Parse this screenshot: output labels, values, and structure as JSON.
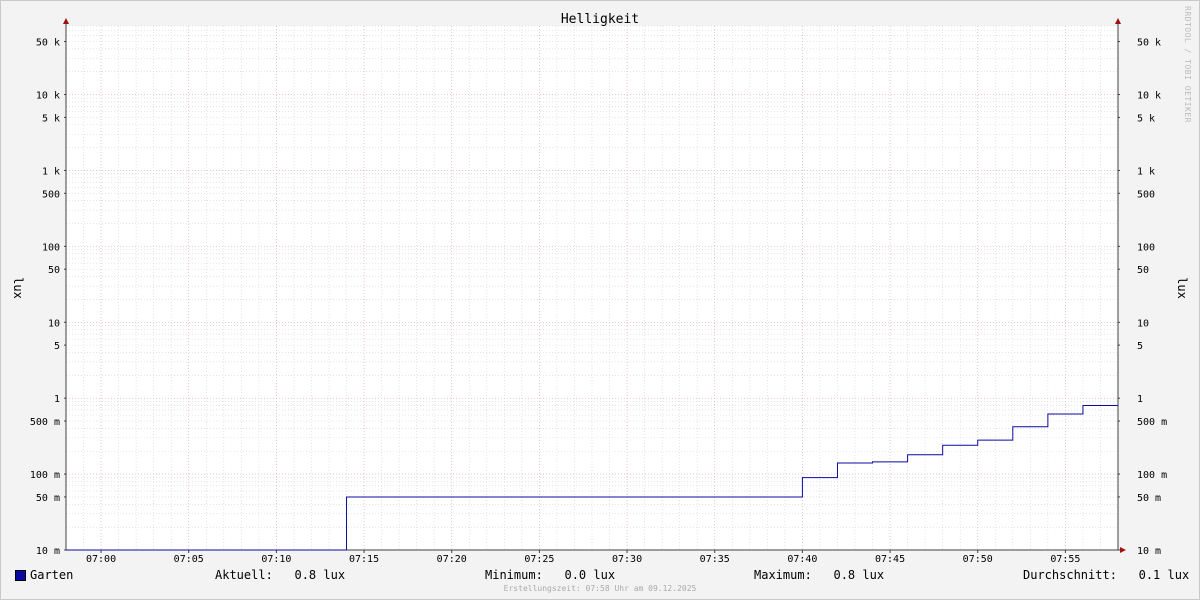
{
  "chart_data": {
    "type": "line",
    "title": "Helligkeit",
    "ylabel": "lux",
    "y_scale": "log",
    "ylim": [
      0.01,
      80000
    ],
    "y_ticks": [
      {
        "value": 0.01,
        "label": "10 m"
      },
      {
        "value": 0.05,
        "label": "50 m"
      },
      {
        "value": 0.1,
        "label": "100 m"
      },
      {
        "value": 0.5,
        "label": "500 m"
      },
      {
        "value": 1,
        "label": "1"
      },
      {
        "value": 5,
        "label": "5"
      },
      {
        "value": 10,
        "label": "10"
      },
      {
        "value": 50,
        "label": "50"
      },
      {
        "value": 100,
        "label": "100"
      },
      {
        "value": 500,
        "label": "500"
      },
      {
        "value": 1000,
        "label": "1 k"
      },
      {
        "value": 5000,
        "label": "5 k"
      },
      {
        "value": 10000,
        "label": "10 k"
      },
      {
        "value": 50000,
        "label": "50 k"
      }
    ],
    "x_ticks": [
      "07:00",
      "07:05",
      "07:10",
      "07:15",
      "07:20",
      "07:25",
      "07:30",
      "07:35",
      "07:40",
      "07:45",
      "07:50",
      "07:55"
    ],
    "xlim": [
      "06:58",
      "07:58"
    ],
    "series": [
      {
        "name": "Garten",
        "color": "#0a0aa0",
        "step": true,
        "points": [
          {
            "x": "06:58",
            "y": 0.01
          },
          {
            "x": "07:14",
            "y": 0.05
          },
          {
            "x": "07:40",
            "y": 0.09
          },
          {
            "x": "07:42",
            "y": 0.14
          },
          {
            "x": "07:44",
            "y": 0.145
          },
          {
            "x": "07:46",
            "y": 0.18
          },
          {
            "x": "07:48",
            "y": 0.24
          },
          {
            "x": "07:50",
            "y": 0.28
          },
          {
            "x": "07:52",
            "y": 0.42
          },
          {
            "x": "07:54",
            "y": 0.62
          },
          {
            "x": "07:56",
            "y": 0.8
          },
          {
            "x": "07:58",
            "y": 0.8
          }
        ]
      }
    ],
    "grid": true
  },
  "legend": {
    "series_name": "Garten",
    "current": "Aktuell:   0.8 lux",
    "minimum": "Minimum:   0.0 lux",
    "maximum": "Maximum:   0.8 lux",
    "average": "Durchschnitt:   0.1 lux"
  },
  "footer": "Erstellungszeit: 07:58 Uhr am 09.12.2025",
  "watermark": "RRDTOOL / TOBI OETIKER"
}
